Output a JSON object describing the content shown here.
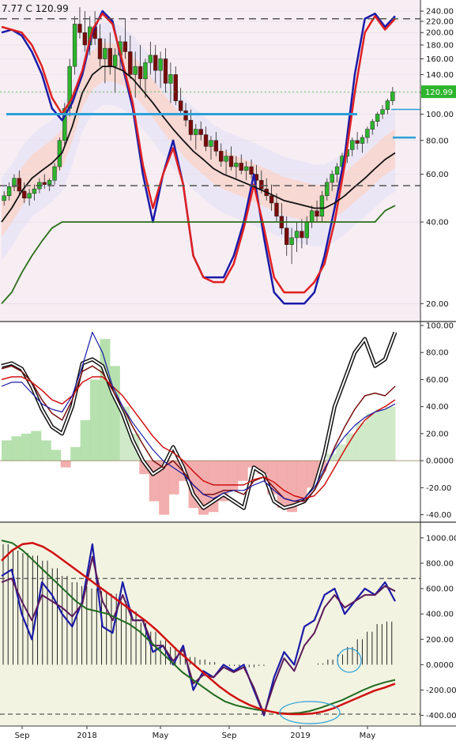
{
  "header": {
    "text": "7.77  C 120.99"
  },
  "x_axis": {
    "labels": [
      "Sep",
      "2018",
      "May",
      "Sep",
      "2019",
      "May"
    ]
  },
  "chart_data": [
    {
      "panel": "price",
      "type": "candlestick",
      "scale": "log",
      "ylim": [
        18,
        250
      ],
      "y_ticks": [
        "240.00",
        "220.00",
        "200.00",
        "180.00",
        "160.00",
        "140.00",
        "120.00",
        "100.00",
        "80.00",
        "60.00",
        "40.00",
        "20.00"
      ],
      "y_tick_values": [
        240,
        220,
        200,
        180,
        160,
        140,
        120,
        100,
        80,
        60,
        40,
        20
      ],
      "last_price_label": "120.99",
      "last_price": 120.99,
      "horizontal_levels": [
        {
          "value": 225,
          "style": "dashed",
          "color": "#555555"
        },
        {
          "value": 54.5,
          "style": "dashed",
          "color": "#555555"
        },
        {
          "value": 100,
          "style": "solid",
          "color": "#2aa0d8"
        },
        {
          "value": 82,
          "style": "short",
          "color": "#2aa0d8"
        }
      ],
      "candles": [
        [
          48,
          52,
          46,
          50
        ],
        [
          50,
          56,
          48,
          54
        ],
        [
          54,
          60,
          52,
          58
        ],
        [
          58,
          62,
          50,
          52
        ],
        [
          52,
          56,
          47,
          49
        ],
        [
          49,
          53,
          46,
          51
        ],
        [
          51,
          55,
          48,
          53
        ],
        [
          53,
          58,
          51,
          56
        ],
        [
          56,
          60,
          53,
          55
        ],
        [
          55,
          58,
          52,
          57
        ],
        [
          57,
          66,
          55,
          64
        ],
        [
          64,
          82,
          62,
          80
        ],
        [
          80,
          110,
          76,
          105
        ],
        [
          105,
          160,
          98,
          150
        ],
        [
          150,
          230,
          140,
          215
        ],
        [
          215,
          248,
          190,
          200
        ],
        [
          200,
          240,
          170,
          180
        ],
        [
          180,
          230,
          165,
          210
        ],
        [
          210,
          240,
          180,
          190
        ],
        [
          190,
          215,
          150,
          160
        ],
        [
          160,
          190,
          130,
          175
        ],
        [
          175,
          200,
          140,
          150
        ],
        [
          150,
          175,
          120,
          165
        ],
        [
          165,
          195,
          145,
          185
        ],
        [
          185,
          225,
          160,
          170
        ],
        [
          170,
          195,
          135,
          140
        ],
        [
          140,
          170,
          115,
          150
        ],
        [
          150,
          180,
          125,
          135
        ],
        [
          135,
          160,
          115,
          155
        ],
        [
          155,
          185,
          140,
          165
        ],
        [
          165,
          180,
          130,
          145
        ],
        [
          145,
          170,
          125,
          160
        ],
        [
          160,
          175,
          120,
          130
        ],
        [
          130,
          155,
          110,
          140
        ],
        [
          140,
          150,
          108,
          112
        ],
        [
          112,
          125,
          100,
          103
        ],
        [
          103,
          110,
          90,
          95
        ],
        [
          95,
          104,
          80,
          84
        ],
        [
          84,
          92,
          74,
          88
        ],
        [
          88,
          94,
          80,
          84
        ],
        [
          84,
          90,
          73,
          76
        ],
        [
          76,
          83,
          68,
          80
        ],
        [
          80,
          86,
          70,
          73
        ],
        [
          73,
          78,
          64,
          67
        ],
        [
          67,
          74,
          60,
          70
        ],
        [
          70,
          76,
          62,
          64
        ],
        [
          64,
          70,
          58,
          66
        ],
        [
          66,
          71,
          60,
          62
        ],
        [
          62,
          67,
          57,
          64
        ],
        [
          64,
          68,
          58,
          60
        ],
        [
          60,
          65,
          55,
          57
        ],
        [
          57,
          62,
          51,
          53
        ],
        [
          53,
          58,
          48,
          50
        ],
        [
          50,
          55,
          44,
          47
        ],
        [
          47,
          51,
          40,
          42
        ],
        [
          42,
          47,
          36,
          38
        ],
        [
          38,
          42,
          30,
          33
        ],
        [
          33,
          38,
          28,
          35
        ],
        [
          35,
          40,
          31,
          37
        ],
        [
          37,
          41,
          32,
          35
        ],
        [
          35,
          42,
          33,
          40
        ],
        [
          40,
          46,
          38,
          44
        ],
        [
          44,
          48,
          40,
          42
        ],
        [
          42,
          52,
          40,
          50
        ],
        [
          50,
          58,
          48,
          56
        ],
        [
          56,
          62,
          52,
          60
        ],
        [
          60,
          66,
          56,
          64
        ],
        [
          64,
          72,
          60,
          70
        ],
        [
          70,
          78,
          66,
          74
        ],
        [
          74,
          82,
          70,
          80
        ],
        [
          80,
          86,
          74,
          78
        ],
        [
          78,
          84,
          72,
          82
        ],
        [
          82,
          90,
          78,
          88
        ],
        [
          88,
          96,
          84,
          94
        ],
        [
          94,
          102,
          90,
          100
        ],
        [
          100,
          108,
          96,
          104
        ],
        [
          104,
          114,
          100,
          112
        ],
        [
          112,
          126,
          108,
          121
        ]
      ],
      "lines": [
        {
          "name": "",
          "color": "#1a1aa8",
          "width": 2.5,
          "values": [
            200,
            205,
            195,
            170,
            140,
            105,
            95,
            110,
            140,
            200,
            240,
            220,
            150,
            105,
            60,
            40,
            60,
            80,
            55,
            30,
            25,
            25,
            25,
            30,
            40,
            60,
            35,
            22,
            20,
            20,
            20,
            22,
            30,
            45,
            70,
            140,
            225,
            235,
            210,
            230
          ]
        },
        {
          "name": "",
          "color": "#e02020",
          "width": 2.5,
          "values": [
            210,
            205,
            200,
            180,
            150,
            115,
            100,
            115,
            145,
            205,
            235,
            215,
            155,
            110,
            65,
            45,
            60,
            75,
            55,
            30,
            25,
            24,
            24,
            28,
            38,
            55,
            38,
            25,
            22,
            22,
            22,
            24,
            28,
            40,
            65,
            120,
            200,
            230,
            205,
            225
          ]
        },
        {
          "name": "",
          "color": "#111111",
          "width": 1.8,
          "values": [
            40,
            45,
            52,
            58,
            62,
            66,
            72,
            90,
            120,
            140,
            150,
            150,
            145,
            135,
            122,
            110,
            98,
            88,
            80,
            73,
            68,
            63,
            60,
            58,
            56,
            54,
            52,
            50,
            48,
            47,
            46,
            45,
            45,
            47,
            50,
            54,
            58,
            63,
            68,
            72
          ]
        },
        {
          "name": "",
          "color": "#2a6e1a",
          "width": 1.8,
          "values": [
            20,
            22,
            26,
            30,
            34,
            38,
            40,
            40,
            40,
            40,
            40,
            40,
            40,
            40,
            40,
            40,
            40,
            40,
            40,
            40,
            40,
            40,
            40,
            40,
            40,
            40,
            40,
            40,
            40,
            40,
            40,
            40,
            40,
            40,
            40,
            40,
            40,
            40,
            44,
            46
          ]
        }
      ]
    },
    {
      "panel": "oscillator",
      "type": "line",
      "ylim": [
        -42,
        100
      ],
      "y_ticks": [
        "100.00",
        "80.00",
        "60.00",
        "40.00",
        "20.00",
        "0.0000",
        "-20.00",
        "-40.00"
      ],
      "y_tick_values": [
        100,
        80,
        60,
        40,
        20,
        0,
        -20,
        -40
      ],
      "lines": [
        {
          "name": "",
          "color": "#111111",
          "width": 2.5,
          "values": [
            70,
            72,
            68,
            55,
            38,
            25,
            20,
            40,
            72,
            75,
            70,
            50,
            35,
            15,
            0,
            -10,
            -5,
            10,
            -5,
            -25,
            -35,
            -30,
            -25,
            -30,
            -35,
            -5,
            -10,
            -30,
            -35,
            -33,
            -30,
            -20,
            5,
            40,
            60,
            80,
            90,
            70,
            75,
            95
          ]
        },
        {
          "name": "",
          "color": "#7a1010",
          "width": 1.5,
          "values": [
            68,
            70,
            66,
            58,
            45,
            35,
            30,
            45,
            66,
            70,
            65,
            52,
            40,
            25,
            12,
            0,
            -5,
            0,
            -8,
            -18,
            -25,
            -25,
            -22,
            -22,
            -25,
            -15,
            -12,
            -20,
            -28,
            -30,
            -30,
            -22,
            -8,
            10,
            25,
            38,
            48,
            50,
            48,
            55
          ]
        },
        {
          "name": "",
          "color": "#d01010",
          "width": 1.5,
          "values": [
            60,
            62,
            62,
            58,
            52,
            45,
            42,
            48,
            58,
            62,
            62,
            55,
            48,
            38,
            28,
            18,
            10,
            6,
            0,
            -8,
            -15,
            -18,
            -18,
            -18,
            -18,
            -14,
            -12,
            -16,
            -22,
            -26,
            -28,
            -26,
            -18,
            -5,
            8,
            20,
            30,
            36,
            40,
            45
          ]
        },
        {
          "name": "",
          "color": "#1a1aa8",
          "width": 1.2,
          "values": [
            55,
            58,
            58,
            50,
            42,
            38,
            36,
            48,
            70,
            95,
            80,
            55,
            40,
            28,
            18,
            8,
            0,
            -5,
            -10,
            -18,
            -25,
            -28,
            -24,
            -22,
            -22,
            -18,
            -15,
            -22,
            -28,
            -30,
            -28,
            -20,
            -6,
            8,
            18,
            26,
            32,
            36,
            38,
            42
          ]
        }
      ],
      "histogram": {
        "values": [
          15,
          18,
          20,
          22,
          15,
          8,
          -5,
          10,
          30,
          60,
          90,
          70,
          40,
          20,
          -10,
          -30,
          -40,
          -25,
          -15,
          -35,
          -40,
          -38,
          -30,
          -22,
          -15,
          -5,
          -10,
          -25,
          -35,
          -38,
          -30,
          -20,
          -8,
          5,
          12,
          20,
          28,
          35,
          38,
          40
        ]
      }
    },
    {
      "panel": "momentum",
      "type": "line",
      "ylim": [
        -440,
        1080
      ],
      "y_ticks": [
        "1000.00",
        "800.00",
        "600.00",
        "400.00",
        "200.00",
        "0.0000",
        "-200.00",
        "-400.00"
      ],
      "y_tick_values": [
        1000,
        800,
        600,
        400,
        200,
        0,
        -200,
        -400
      ],
      "horizontal_levels": [
        {
          "value": 680,
          "style": "dashed",
          "color": "#333333"
        },
        {
          "value": -390,
          "style": "dashed",
          "color": "#333333"
        }
      ],
      "lines": [
        {
          "name": "",
          "color": "#1a1aa8",
          "width": 2.2,
          "values": [
            700,
            750,
            400,
            200,
            650,
            550,
            400,
            300,
            500,
            950,
            300,
            250,
            650,
            350,
            350,
            100,
            150,
            0,
            150,
            -200,
            -50,
            -100,
            0,
            -50,
            0,
            -200,
            -400,
            -100,
            100,
            0,
            300,
            350,
            550,
            600,
            400,
            500,
            600,
            550,
            650,
            500
          ]
        },
        {
          "name": "",
          "color": "#5a1a5a",
          "width": 2,
          "values": [
            650,
            680,
            500,
            350,
            550,
            500,
            450,
            380,
            480,
            850,
            500,
            350,
            550,
            350,
            350,
            150,
            150,
            30,
            120,
            -150,
            -80,
            -100,
            -20,
            -60,
            -20,
            -180,
            -390,
            -150,
            50,
            -50,
            150,
            250,
            450,
            550,
            450,
            500,
            550,
            550,
            620,
            580
          ]
        },
        {
          "name": "",
          "color": "#1e6a1e",
          "width": 2,
          "values": [
            980,
            960,
            900,
            820,
            740,
            660,
            580,
            500,
            440,
            420,
            400,
            360,
            320,
            260,
            180,
            100,
            20,
            -60,
            -120,
            -180,
            -240,
            -290,
            -320,
            -340,
            -355,
            -365,
            -380,
            -385,
            -380,
            -365,
            -340,
            -310,
            -280,
            -240,
            -200,
            -165,
            -140,
            -120
          ]
        },
        {
          "name": "",
          "color": "#d01010",
          "width": 2.5,
          "values": [
            820,
            900,
            950,
            960,
            930,
            880,
            820,
            760,
            700,
            640,
            580,
            520,
            460,
            400,
            340,
            270,
            190,
            110,
            40,
            -30,
            -100,
            -170,
            -230,
            -280,
            -320,
            -350,
            -370,
            -385,
            -390,
            -390,
            -385,
            -370,
            -345,
            -310,
            -275,
            -240,
            -205,
            -180,
            -150
          ]
        }
      ],
      "histogram": {
        "values": [
          950,
          900,
          880,
          860,
          820,
          760,
          700,
          650,
          620,
          600,
          580,
          560,
          500,
          420,
          330,
          260,
          190,
          140,
          100,
          60,
          40,
          20,
          0,
          -10,
          -20,
          -20,
          -10,
          0,
          0,
          0,
          0,
          0,
          10,
          40,
          80,
          140,
          200,
          260,
          320,
          340
        ]
      }
    }
  ]
}
